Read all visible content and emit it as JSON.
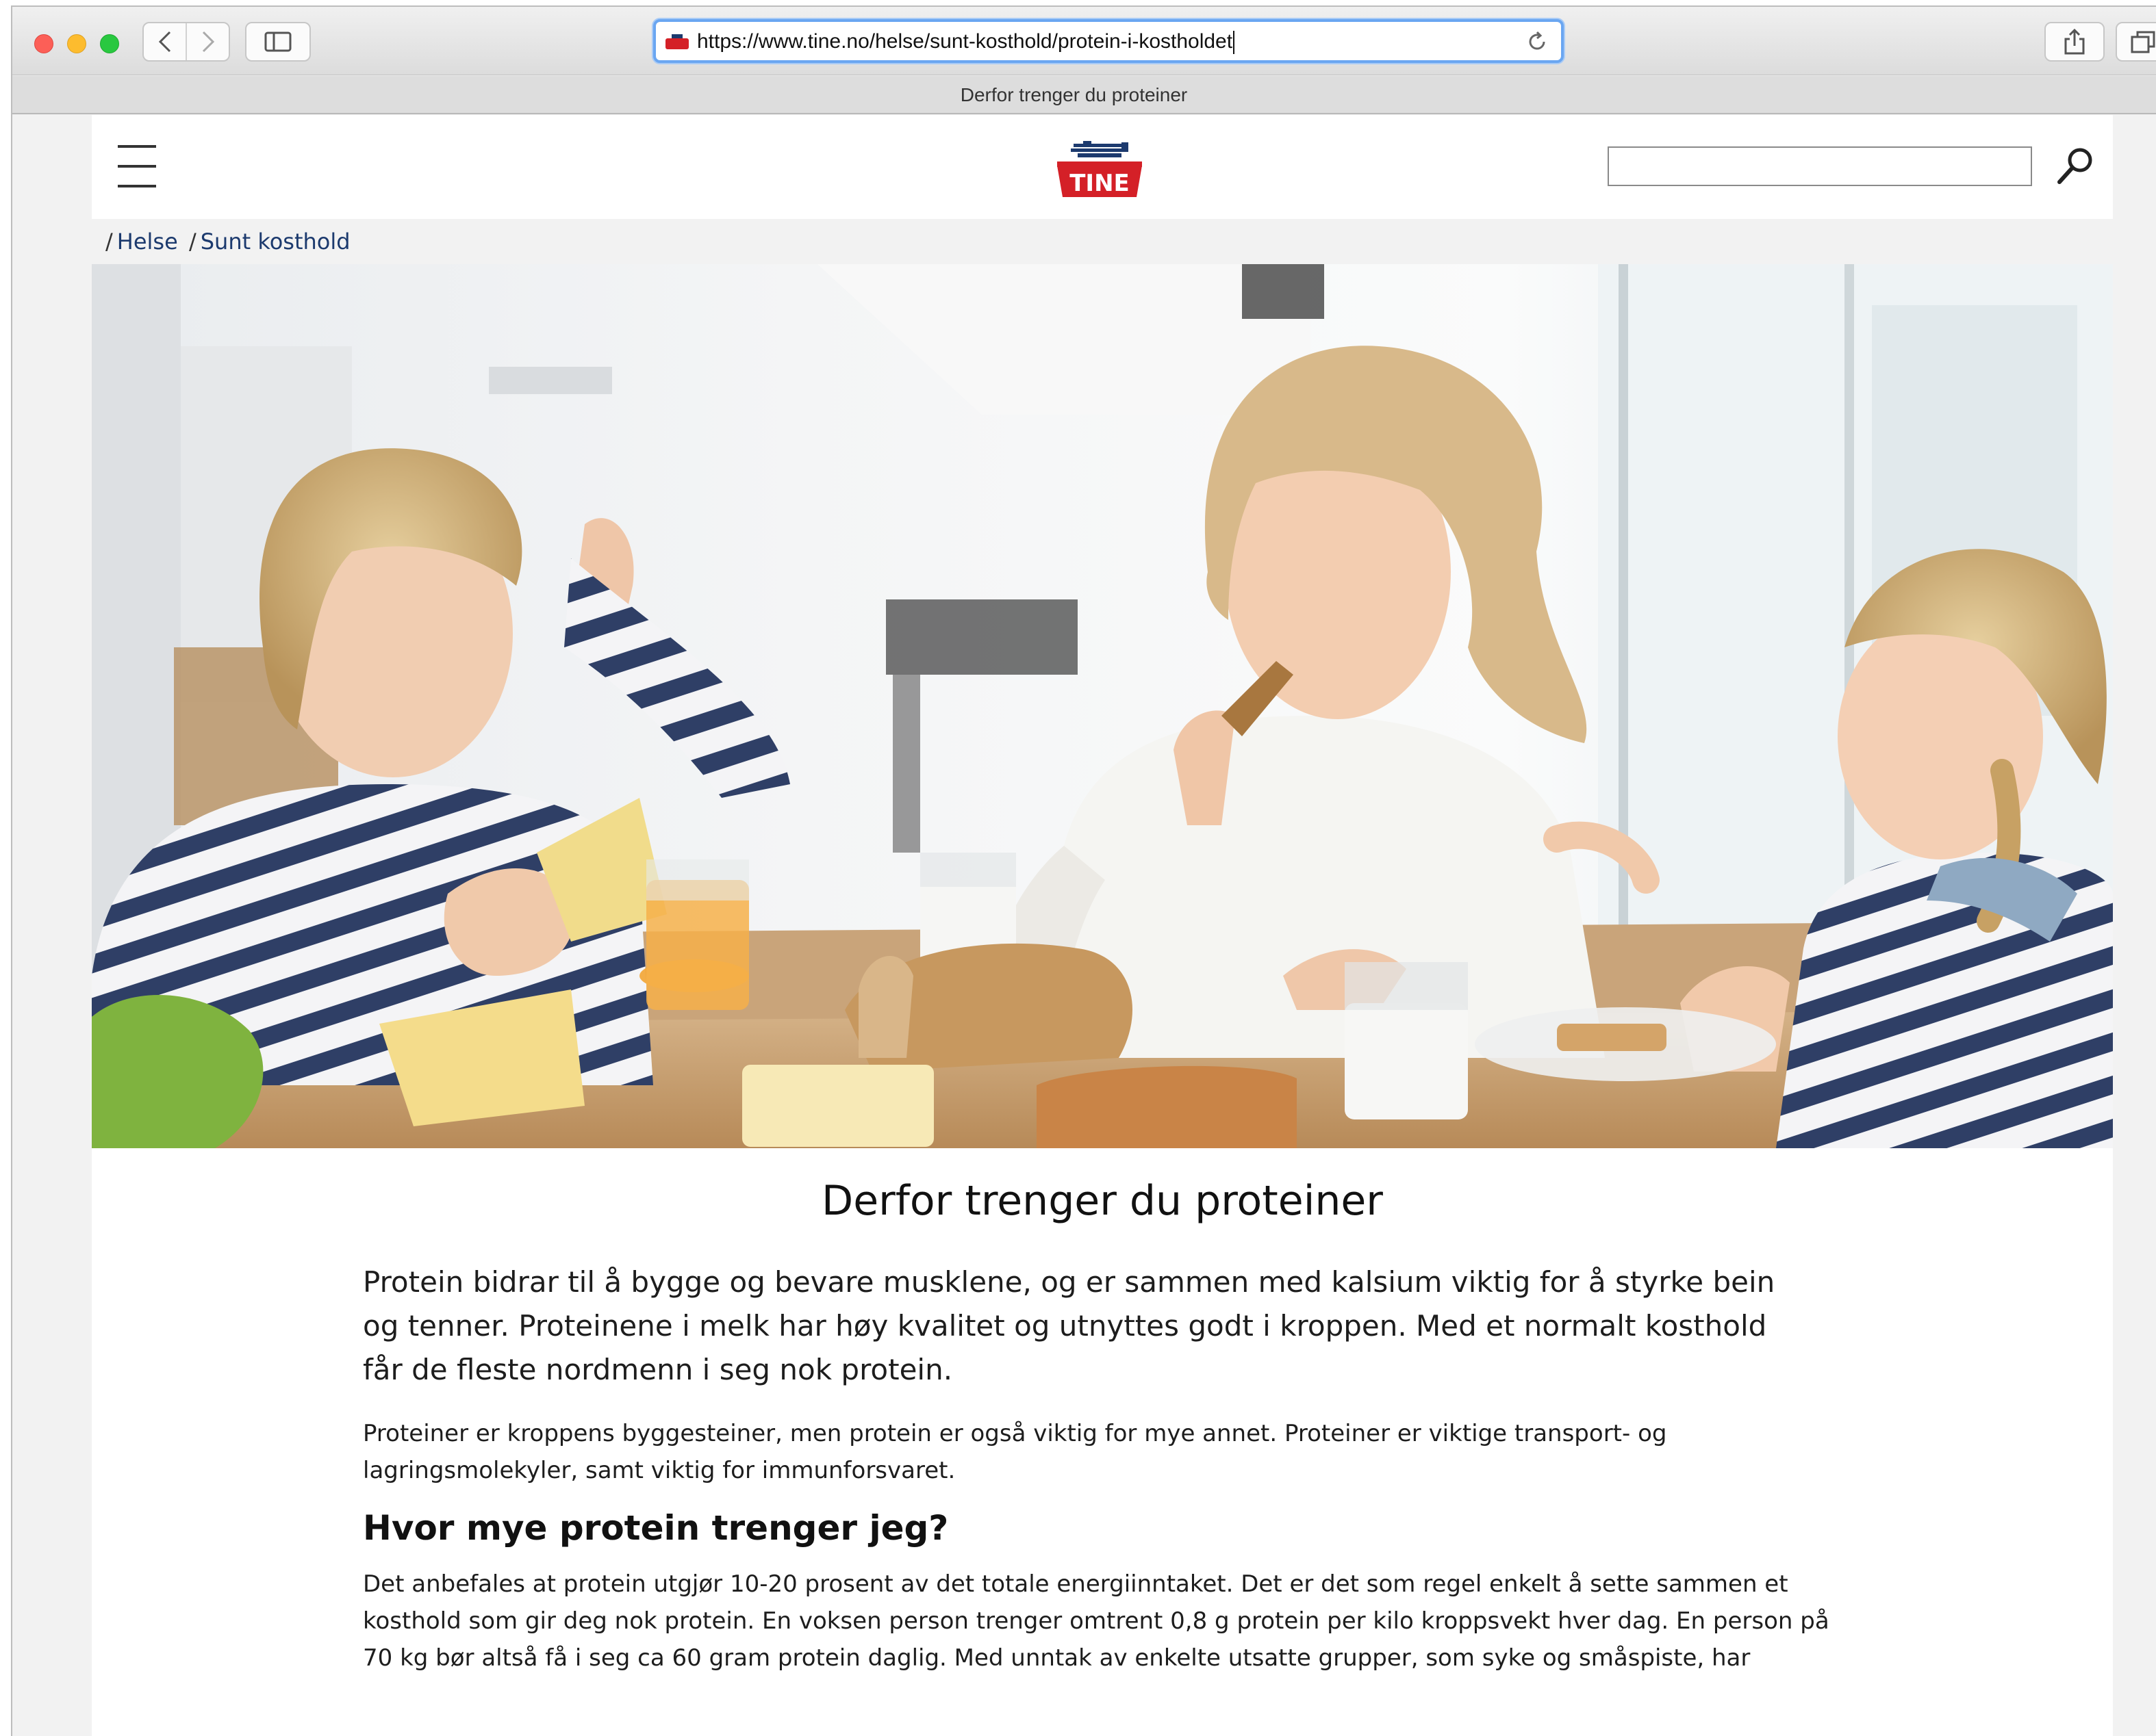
{
  "browser": {
    "url": "https://www.tine.no/helse/sunt-kosthold/protein-i-kostholdet",
    "tab_title": "Derfor trenger du proteiner",
    "icons": [
      "back-icon",
      "forward-icon",
      "sidebar-icon",
      "reload-icon",
      "share-icon",
      "tabs-icon"
    ]
  },
  "header": {
    "logo_text": "TINE",
    "search_placeholder": "",
    "icons": [
      "menu-icon",
      "search-icon"
    ]
  },
  "breadcrumb": {
    "sep1": "/",
    "item1": "Helse",
    "sep2": "/",
    "item2": "Sunt kosthold"
  },
  "article": {
    "title": "Derfor trenger du proteiner",
    "lead": "Protein bidrar til å bygge og bevare musklene, og er sammen med kalsium viktig for å styrke bein og tenner. Proteinene i melk har høy kvalitet og utnyttes godt i kroppen. Med et normalt kosthold får de fleste nordmenn i seg nok protein.",
    "paragraph1": "Proteiner er kroppens byggesteiner, men protein er også viktig for mye annet. Proteiner er viktige transport- og lagringsmolekyler, samt viktig for immunforsvaret.",
    "heading2": "Hvor mye protein trenger jeg?",
    "paragraph2": "Det anbefales at protein utgjør 10-20 prosent av det totale energiinntaket. Det er det som regel enkelt å sette sammen et kosthold som gir deg nok protein. En voksen person trenger omtrent 0,8 g protein per kilo kroppsvekt hver dag. En person på 70 kg bør altså få i seg ca 60 gram protein daglig. Med unntak av enkelte utsatte grupper, som syke og småspiste, har"
  },
  "colors": {
    "brand_red": "#d42027",
    "brand_blue": "#1c3a6e",
    "url_focus": "#6aa6f1"
  }
}
